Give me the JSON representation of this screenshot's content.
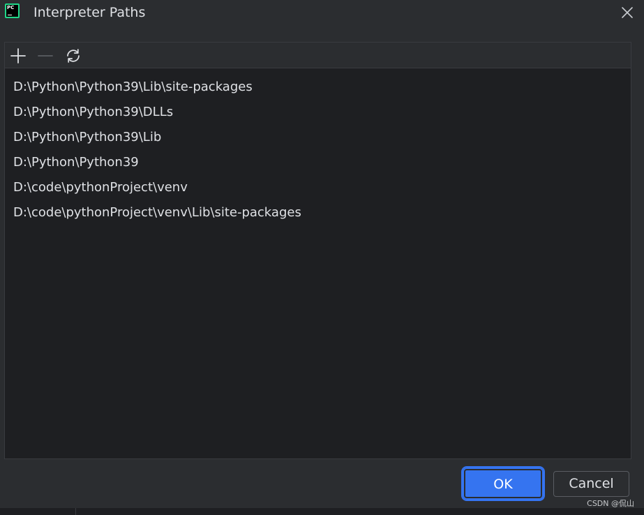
{
  "window": {
    "title": "Interpreter Paths",
    "app_icon_text": "PC",
    "app_icon": "pycharm-logo",
    "close_icon": "close-icon"
  },
  "toolbar": {
    "add_icon": "plus-icon",
    "remove_icon": "minus-icon",
    "reload_icon": "reload-icon"
  },
  "paths": [
    "D:\\Python\\Python39\\Lib\\site-packages",
    "D:\\Python\\Python39\\DLLs",
    "D:\\Python\\Python39\\Lib",
    "D:\\Python\\Python39",
    "D:\\code\\pythonProject\\venv",
    "D:\\code\\pythonProject\\venv\\Lib\\site-packages"
  ],
  "buttons": {
    "ok_label": "OK",
    "cancel_label": "Cancel"
  },
  "watermark": "CSDN @侃山",
  "colors": {
    "background": "#2b2d30",
    "list_background": "#1e1f22",
    "accent": "#3574f0",
    "text": "#dfe1e5"
  }
}
